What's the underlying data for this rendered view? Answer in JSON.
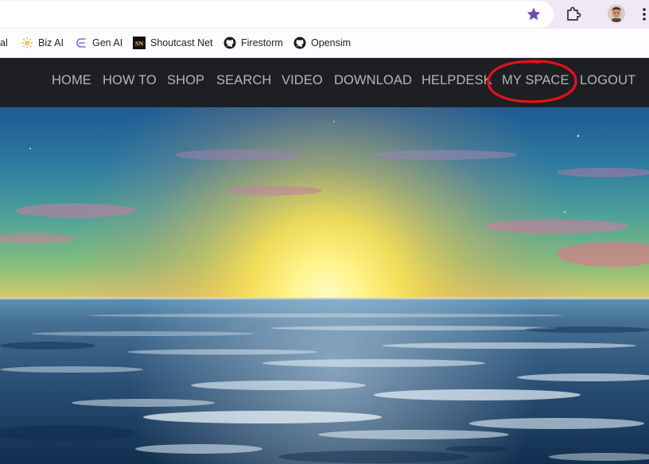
{
  "browser": {
    "bookmarks": [
      {
        "label": "al",
        "icon": "none"
      },
      {
        "label": "Biz AI",
        "icon": "biz-ai-icon"
      },
      {
        "label": "Gen AI",
        "icon": "gen-ai-icon"
      },
      {
        "label": "Shoutcast Net",
        "icon": "shoutcast-icon",
        "icon_text": "SN"
      },
      {
        "label": "Firestorm",
        "icon": "github-icon"
      },
      {
        "label": "Opensim",
        "icon": "github-icon"
      }
    ],
    "colors": {
      "frame": "#efe9f6",
      "star": "#6e4bb0"
    }
  },
  "site": {
    "nav": [
      {
        "label": "HOME"
      },
      {
        "label": "HOW TO"
      },
      {
        "label": "SHOP"
      },
      {
        "label": "SEARCH"
      },
      {
        "label": "VIDEO"
      },
      {
        "label": "DOWNLOAD"
      },
      {
        "label": "HELPDESK"
      },
      {
        "label": "MY SPACE",
        "highlighted": true
      },
      {
        "label": "LOGOUT"
      }
    ],
    "colors": {
      "navbar": "#1e1f22",
      "nav_text": "#b4b6b9",
      "annotation": "#e2121a"
    }
  }
}
